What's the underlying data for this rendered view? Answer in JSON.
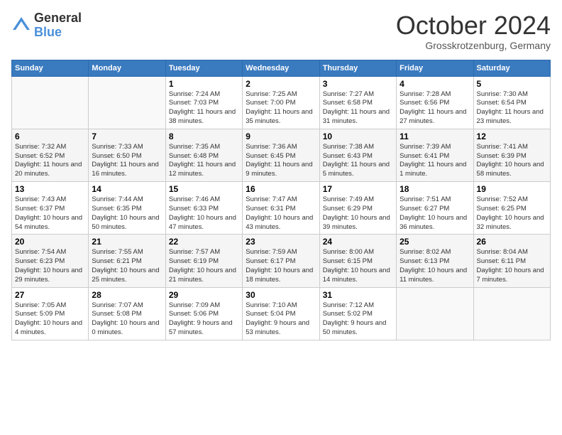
{
  "header": {
    "logo_line1": "General",
    "logo_line2": "Blue",
    "month": "October 2024",
    "location": "Grosskrotzenburg, Germany"
  },
  "weekdays": [
    "Sunday",
    "Monday",
    "Tuesday",
    "Wednesday",
    "Thursday",
    "Friday",
    "Saturday"
  ],
  "weeks": [
    [
      {
        "day": "",
        "content": ""
      },
      {
        "day": "",
        "content": ""
      },
      {
        "day": "1",
        "content": "Sunrise: 7:24 AM\nSunset: 7:03 PM\nDaylight: 11 hours and 38 minutes."
      },
      {
        "day": "2",
        "content": "Sunrise: 7:25 AM\nSunset: 7:00 PM\nDaylight: 11 hours and 35 minutes."
      },
      {
        "day": "3",
        "content": "Sunrise: 7:27 AM\nSunset: 6:58 PM\nDaylight: 11 hours and 31 minutes."
      },
      {
        "day": "4",
        "content": "Sunrise: 7:28 AM\nSunset: 6:56 PM\nDaylight: 11 hours and 27 minutes."
      },
      {
        "day": "5",
        "content": "Sunrise: 7:30 AM\nSunset: 6:54 PM\nDaylight: 11 hours and 23 minutes."
      }
    ],
    [
      {
        "day": "6",
        "content": "Sunrise: 7:32 AM\nSunset: 6:52 PM\nDaylight: 11 hours and 20 minutes."
      },
      {
        "day": "7",
        "content": "Sunrise: 7:33 AM\nSunset: 6:50 PM\nDaylight: 11 hours and 16 minutes."
      },
      {
        "day": "8",
        "content": "Sunrise: 7:35 AM\nSunset: 6:48 PM\nDaylight: 11 hours and 12 minutes."
      },
      {
        "day": "9",
        "content": "Sunrise: 7:36 AM\nSunset: 6:45 PM\nDaylight: 11 hours and 9 minutes."
      },
      {
        "day": "10",
        "content": "Sunrise: 7:38 AM\nSunset: 6:43 PM\nDaylight: 11 hours and 5 minutes."
      },
      {
        "day": "11",
        "content": "Sunrise: 7:39 AM\nSunset: 6:41 PM\nDaylight: 11 hours and 1 minute."
      },
      {
        "day": "12",
        "content": "Sunrise: 7:41 AM\nSunset: 6:39 PM\nDaylight: 10 hours and 58 minutes."
      }
    ],
    [
      {
        "day": "13",
        "content": "Sunrise: 7:43 AM\nSunset: 6:37 PM\nDaylight: 10 hours and 54 minutes."
      },
      {
        "day": "14",
        "content": "Sunrise: 7:44 AM\nSunset: 6:35 PM\nDaylight: 10 hours and 50 minutes."
      },
      {
        "day": "15",
        "content": "Sunrise: 7:46 AM\nSunset: 6:33 PM\nDaylight: 10 hours and 47 minutes."
      },
      {
        "day": "16",
        "content": "Sunrise: 7:47 AM\nSunset: 6:31 PM\nDaylight: 10 hours and 43 minutes."
      },
      {
        "day": "17",
        "content": "Sunrise: 7:49 AM\nSunset: 6:29 PM\nDaylight: 10 hours and 39 minutes."
      },
      {
        "day": "18",
        "content": "Sunrise: 7:51 AM\nSunset: 6:27 PM\nDaylight: 10 hours and 36 minutes."
      },
      {
        "day": "19",
        "content": "Sunrise: 7:52 AM\nSunset: 6:25 PM\nDaylight: 10 hours and 32 minutes."
      }
    ],
    [
      {
        "day": "20",
        "content": "Sunrise: 7:54 AM\nSunset: 6:23 PM\nDaylight: 10 hours and 29 minutes."
      },
      {
        "day": "21",
        "content": "Sunrise: 7:55 AM\nSunset: 6:21 PM\nDaylight: 10 hours and 25 minutes."
      },
      {
        "day": "22",
        "content": "Sunrise: 7:57 AM\nSunset: 6:19 PM\nDaylight: 10 hours and 21 minutes."
      },
      {
        "day": "23",
        "content": "Sunrise: 7:59 AM\nSunset: 6:17 PM\nDaylight: 10 hours and 18 minutes."
      },
      {
        "day": "24",
        "content": "Sunrise: 8:00 AM\nSunset: 6:15 PM\nDaylight: 10 hours and 14 minutes."
      },
      {
        "day": "25",
        "content": "Sunrise: 8:02 AM\nSunset: 6:13 PM\nDaylight: 10 hours and 11 minutes."
      },
      {
        "day": "26",
        "content": "Sunrise: 8:04 AM\nSunset: 6:11 PM\nDaylight: 10 hours and 7 minutes."
      }
    ],
    [
      {
        "day": "27",
        "content": "Sunrise: 7:05 AM\nSunset: 5:09 PM\nDaylight: 10 hours and 4 minutes."
      },
      {
        "day": "28",
        "content": "Sunrise: 7:07 AM\nSunset: 5:08 PM\nDaylight: 10 hours and 0 minutes."
      },
      {
        "day": "29",
        "content": "Sunrise: 7:09 AM\nSunset: 5:06 PM\nDaylight: 9 hours and 57 minutes."
      },
      {
        "day": "30",
        "content": "Sunrise: 7:10 AM\nSunset: 5:04 PM\nDaylight: 9 hours and 53 minutes."
      },
      {
        "day": "31",
        "content": "Sunrise: 7:12 AM\nSunset: 5:02 PM\nDaylight: 9 hours and 50 minutes."
      },
      {
        "day": "",
        "content": ""
      },
      {
        "day": "",
        "content": ""
      }
    ]
  ]
}
